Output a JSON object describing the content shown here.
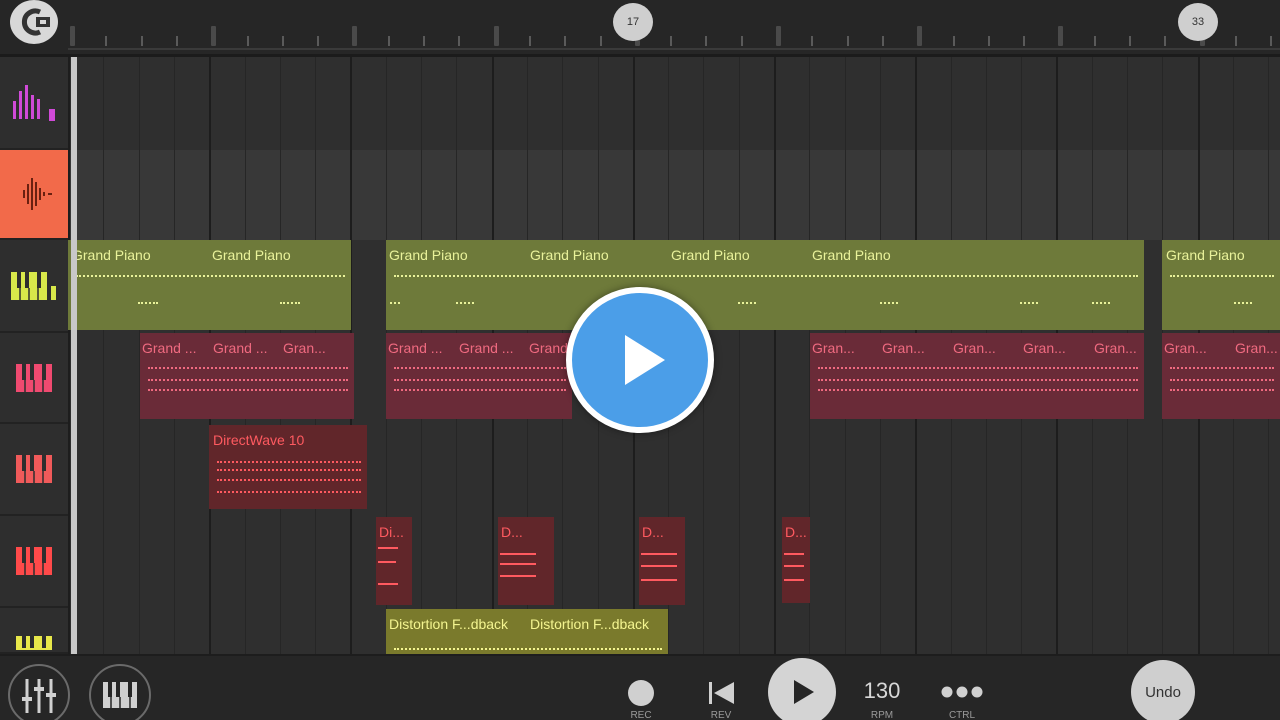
{
  "ruler": {
    "markers": [
      "17",
      "33"
    ]
  },
  "tracks": [
    {
      "icon": "mixer-bars-icon",
      "color": "#d04ad8"
    },
    {
      "icon": "waveform-icon",
      "color": "#f26a4a",
      "active": true
    },
    {
      "icon": "keyboard-icon",
      "color": "#d8e84a"
    },
    {
      "icon": "keyboard-icon",
      "color": "#f04a70"
    },
    {
      "icon": "keyboard-icon",
      "color": "#f05a5a"
    },
    {
      "icon": "keyboard-icon",
      "color": "#ff4a4a"
    },
    {
      "icon": "keyboard-icon",
      "color": "#e8e84a"
    }
  ],
  "clips": {
    "piano_title": "Grand Piano",
    "piano_titles": [
      "Grand Piano",
      "Grand Piano",
      "Grand Piano",
      "Grand Piano",
      "Grand Piano",
      "Grand Piano",
      "Grand Piano"
    ],
    "pink_titles": [
      "Grand ...",
      "Grand ...",
      "Gran...",
      "Grand ...",
      "Grand ...",
      "Grand",
      "Gran...",
      "Gran...",
      "Gran...",
      "Gran...",
      "Gran...",
      "Gran...",
      "Gran..."
    ],
    "directwave_title": "DirectWave 10",
    "d_titles": [
      "Di...",
      "D...",
      "D...",
      "D..."
    ],
    "dist_titles": [
      "Distortion F...dback",
      "Distortion F...dback"
    ]
  },
  "transport": {
    "rec_label": "REC",
    "rev_label": "REV",
    "bpm_value": "130",
    "bpm_label": "RPM",
    "ctrl_label": "CTRL",
    "undo_label": "Undo"
  },
  "colors": {
    "accent_active_track": "#f26a4a",
    "play_overlay": "#4b9ee8"
  }
}
